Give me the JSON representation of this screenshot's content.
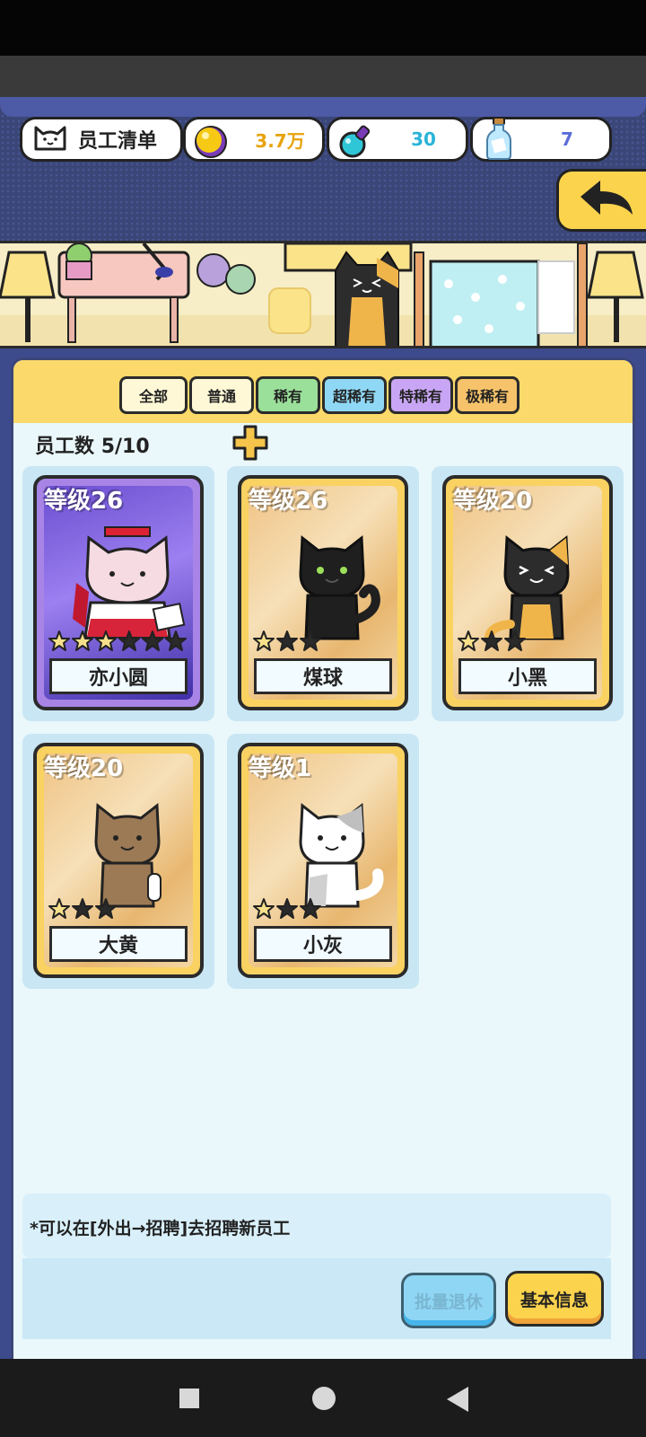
{
  "header": {
    "title": "员工清单",
    "title_icon": "cat-face-icon",
    "gold": "3.7万",
    "gold_color": "#e8a20c",
    "potion": "30",
    "potion_color": "#2ab4d8",
    "bottle": "7",
    "bottle_color": "#5b6ed6",
    "back_icon": "back-arrow-icon"
  },
  "tabs": [
    {
      "label": "全部",
      "color": "#fff8d6"
    },
    {
      "label": "普通",
      "color": "#fff8d6"
    },
    {
      "label": "稀有",
      "color": "#9be09a"
    },
    {
      "label": "超稀有",
      "color": "#8fd8f5"
    },
    {
      "label": "特稀有",
      "color": "#c9a6f5"
    },
    {
      "label": "极稀有",
      "color": "#f6c36a"
    }
  ],
  "staff": {
    "count_label": "员工数",
    "count_value": "5/10",
    "add_icon": "plus-icon",
    "cards": [
      {
        "level": "等级26",
        "name": "亦小圆",
        "stars_filled": 3,
        "stars_total": 6,
        "rarity": "purple",
        "cat": "shrine-cat"
      },
      {
        "level": "等级26",
        "name": "煤球",
        "stars_filled": 1,
        "stars_total": 3,
        "rarity": "gold",
        "cat": "black-cat"
      },
      {
        "level": "等级20",
        "name": "小黑",
        "stars_filled": 1,
        "stars_total": 3,
        "rarity": "gold",
        "cat": "black-orange-cat"
      },
      {
        "level": "等级20",
        "name": "大黄",
        "stars_filled": 1,
        "stars_total": 3,
        "rarity": "gold",
        "cat": "brown-cat"
      },
      {
        "level": "等级1",
        "name": "小灰",
        "stars_filled": 1,
        "stars_total": 3,
        "rarity": "gold",
        "cat": "gray-white-cat"
      }
    ]
  },
  "note": "*可以在[外出→招聘]去招聘新员工",
  "buttons": {
    "batch_retire": "批量退休",
    "basic_info": "基本信息"
  }
}
